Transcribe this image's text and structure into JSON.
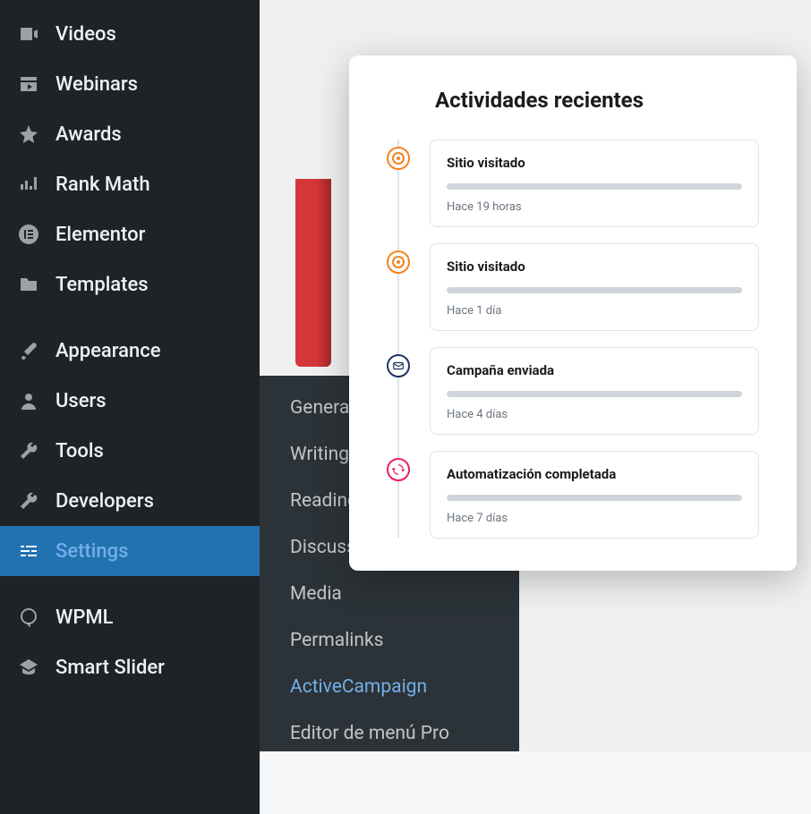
{
  "sidebar": {
    "items": [
      {
        "label": "Videos",
        "icon": "video"
      },
      {
        "label": "Webinars",
        "icon": "calendar-play"
      },
      {
        "label": "Awards",
        "icon": "star"
      },
      {
        "label": "Rank Math",
        "icon": "chart"
      },
      {
        "label": "Elementor",
        "icon": "elementor"
      },
      {
        "label": "Templates",
        "icon": "folder"
      },
      {
        "label": "Appearance",
        "icon": "brush"
      },
      {
        "label": "Users",
        "icon": "user"
      },
      {
        "label": "Tools",
        "icon": "wrench"
      },
      {
        "label": "Developers",
        "icon": "wrench"
      },
      {
        "label": "Settings",
        "icon": "sliders",
        "active": true
      },
      {
        "label": "WPML",
        "icon": "wpml"
      },
      {
        "label": "Smart Slider",
        "icon": "grad-cap"
      }
    ]
  },
  "submenu": {
    "items": [
      {
        "label": "General"
      },
      {
        "label": "Writing"
      },
      {
        "label": "Reading"
      },
      {
        "label": "Discussion"
      },
      {
        "label": "Media"
      },
      {
        "label": "Permalinks"
      },
      {
        "label": "ActiveCampaign",
        "active": true
      },
      {
        "label": "Editor de menú Pro"
      }
    ]
  },
  "activity": {
    "title": "Actividades recientes",
    "items": [
      {
        "heading": "Sitio visitado",
        "time": "Hace 19 horas",
        "badge": "target"
      },
      {
        "heading": "Sitio visitado",
        "time": "Hace 1 día",
        "badge": "target"
      },
      {
        "heading": "Campaña enviada",
        "time": "Hace 4 días",
        "badge": "mail"
      },
      {
        "heading": "Automatización completada",
        "time": "Hace 7 días",
        "badge": "auto"
      }
    ]
  }
}
